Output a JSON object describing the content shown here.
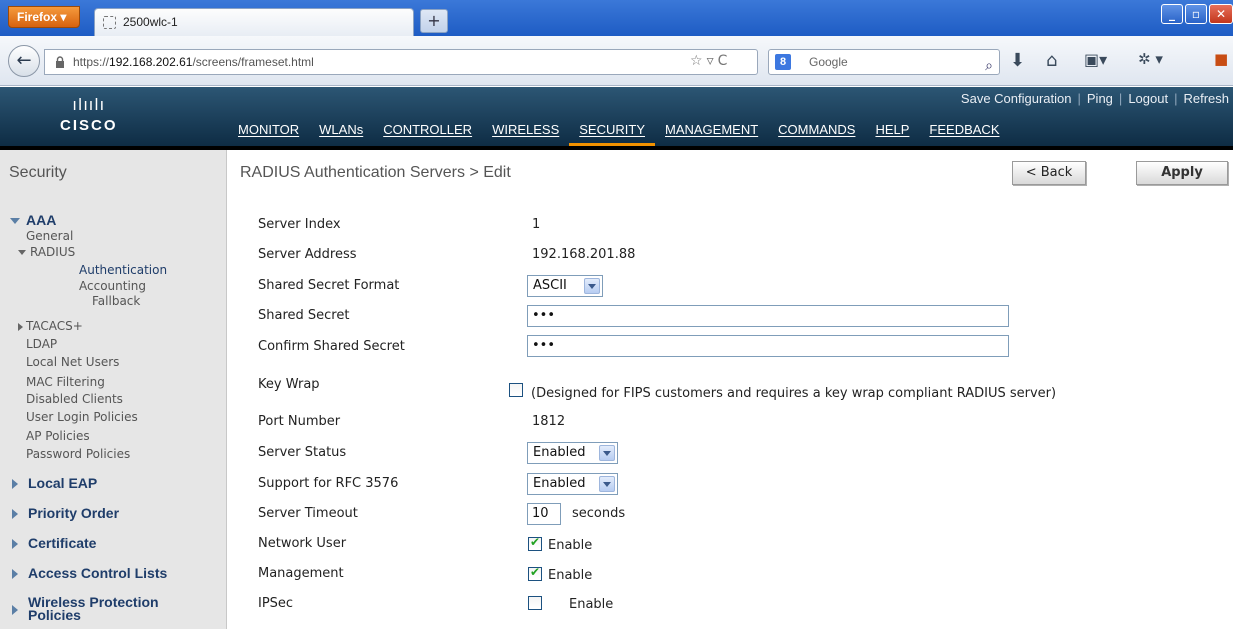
{
  "browser": {
    "menu_button": "Firefox ▾",
    "tab_title": "2500wlc-1",
    "new_tab": "+",
    "url_prefix": "https://",
    "url_host": "192.168.202.61",
    "url_path": "/screens/frameset.html",
    "search_placeholder": "Google",
    "search_engine_glyph": "8",
    "icons": [
      "back-arrow-icon",
      "lock-icon",
      "star-icon",
      "reload-icon",
      "search-icon",
      "download-icon",
      "home-icon",
      "bookmarks-icon",
      "addon-icon"
    ]
  },
  "cisco": {
    "logo_bars": "ılıılı",
    "logo_word": "CISCO",
    "top_links": [
      "Save Configuration",
      "Ping",
      "Logout",
      "Refresh"
    ],
    "nav": [
      "MONITOR",
      "WLANs",
      "CONTROLLER",
      "WIRELESS",
      "SECURITY",
      "MANAGEMENT",
      "COMMANDS",
      "HELP",
      "FEEDBACK"
    ],
    "active_nav": "SECURITY",
    "accent_color": "#f39200"
  },
  "sidebar": {
    "title": "Security",
    "aaa": "AAA",
    "general": "General",
    "radius": "RADIUS",
    "authentication": "Authentication",
    "accounting": "Accounting",
    "fallback": "Fallback",
    "tacacs": "TACACS+",
    "ldap": "LDAP",
    "local_net_users": "Local Net Users",
    "mac_filtering": "MAC Filtering",
    "disabled_clients": "Disabled Clients",
    "user_login_policies": "User Login Policies",
    "ap_policies": "AP Policies",
    "password_policies": "Password Policies",
    "local_eap": "Local EAP",
    "priority_order": "Priority Order",
    "certificate": "Certificate",
    "acl": "Access Control Lists",
    "wireless_protection_1": "Wireless Protection",
    "wireless_protection_2": "Policies"
  },
  "content": {
    "title": "RADIUS Authentication Servers > Edit",
    "back_button": "< Back",
    "apply_button": "Apply",
    "labels": {
      "server_index": "Server Index",
      "server_address": "Server Address",
      "secret_format": "Shared Secret Format",
      "shared_secret": "Shared Secret",
      "confirm_secret": "Confirm Shared Secret",
      "key_wrap": "Key Wrap",
      "port_number": "Port Number",
      "server_status": "Server Status",
      "rfc3576": "Support for RFC 3576",
      "server_timeout": "Server Timeout",
      "network_user": "Network User",
      "management": "Management",
      "ipsec": "IPSec"
    },
    "values": {
      "server_index": "1",
      "server_address": "192.168.201.88",
      "secret_format": "ASCII",
      "shared_secret": "•••",
      "confirm_secret": "•••",
      "key_wrap_checked": false,
      "key_wrap_note": "(Designed for FIPS customers and requires a key wrap compliant RADIUS server)",
      "port_number": "1812",
      "server_status": "Enabled",
      "rfc3576": "Enabled",
      "server_timeout": "10",
      "timeout_unit": "seconds",
      "network_user_checked": true,
      "network_user_label": "Enable",
      "management_checked": true,
      "management_label": "Enable",
      "ipsec_checked": false,
      "ipsec_label": "Enable"
    }
  }
}
